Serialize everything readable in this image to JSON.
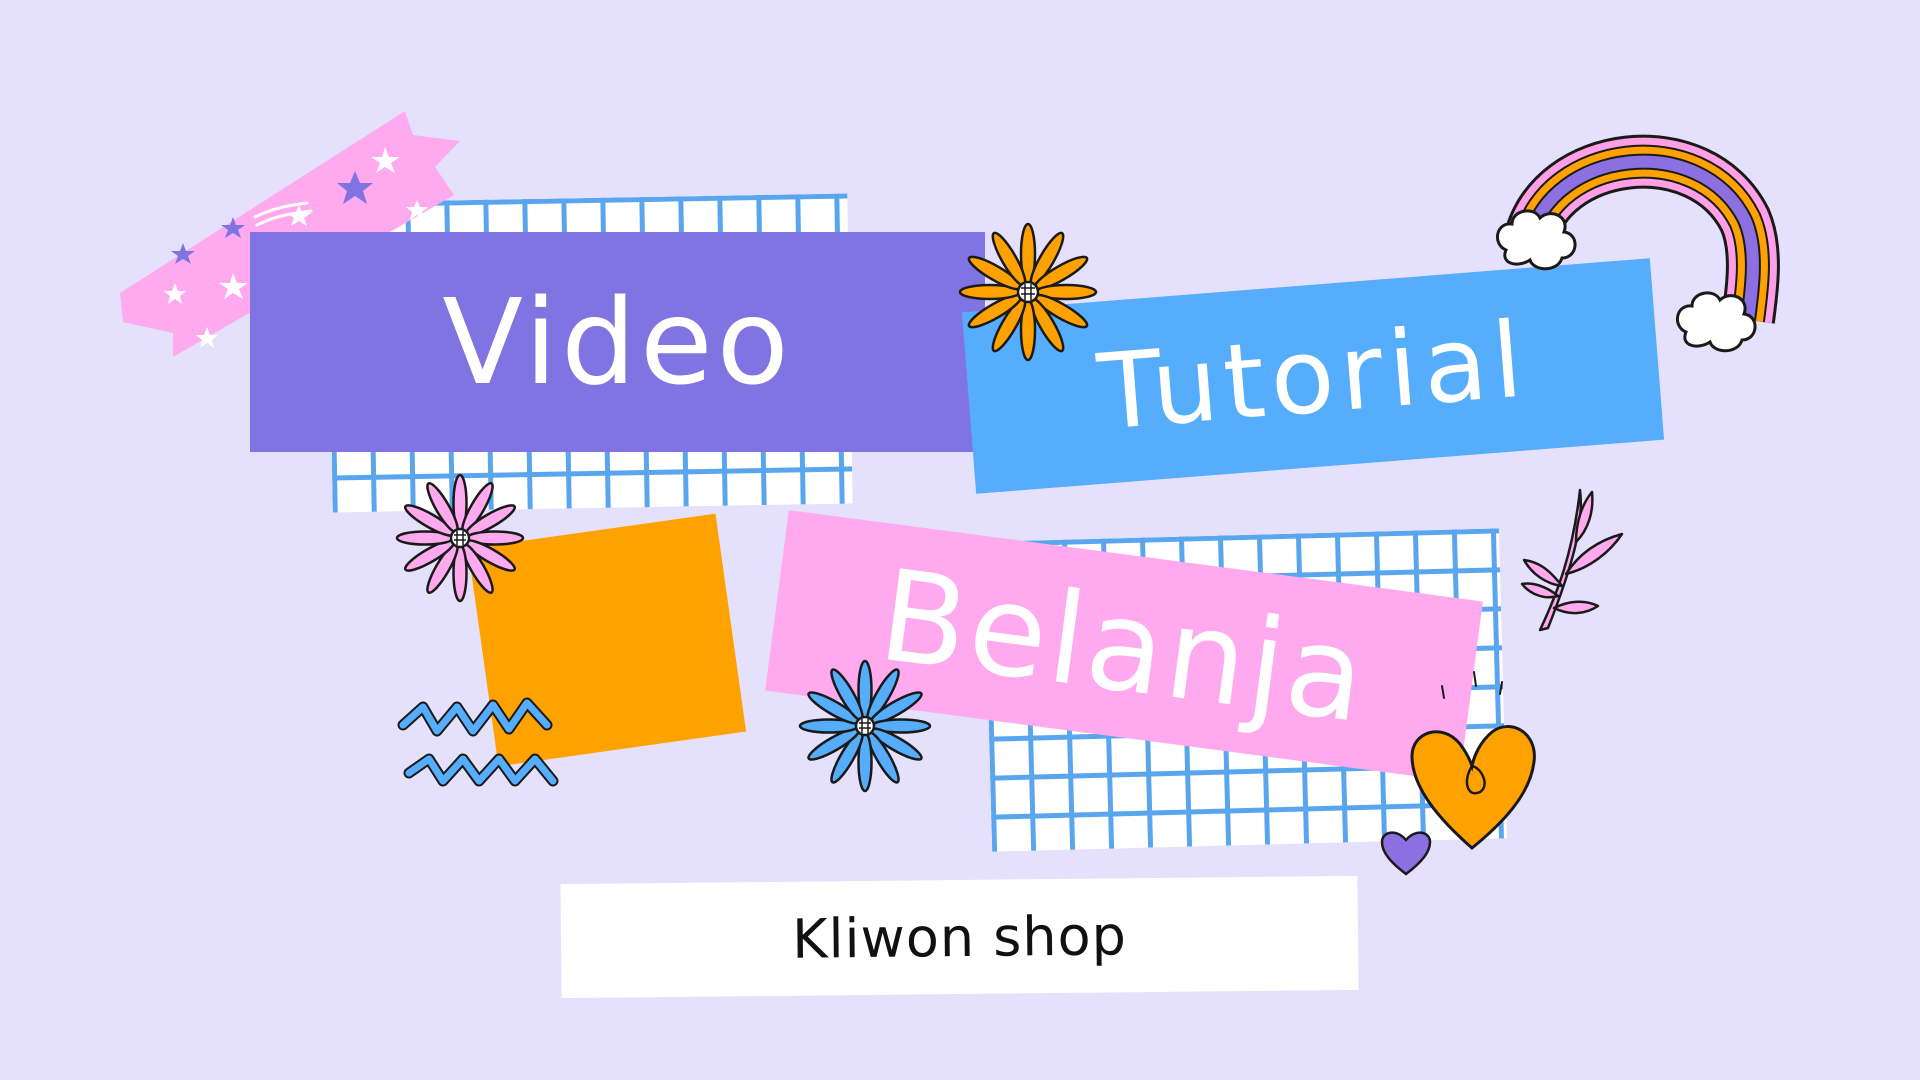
{
  "title": {
    "word_1": "Video",
    "word_2": "Tutorial",
    "word_3": "Belanja"
  },
  "subtitle": "Kliwon shop",
  "colors": {
    "background": "#e5e1fd",
    "purple_block": "#7f74e2",
    "blue_block": "#55adfb",
    "pink_block": "#ffaaee",
    "orange_block": "#ffa200",
    "grid_line": "#5aa6ee"
  },
  "decorations": [
    "washi-tape-stars",
    "grid-paper",
    "flower-icon",
    "rainbow-icon",
    "cloud-icon",
    "zigzag-icon",
    "heart-icon",
    "leaf-branch-icon"
  ]
}
